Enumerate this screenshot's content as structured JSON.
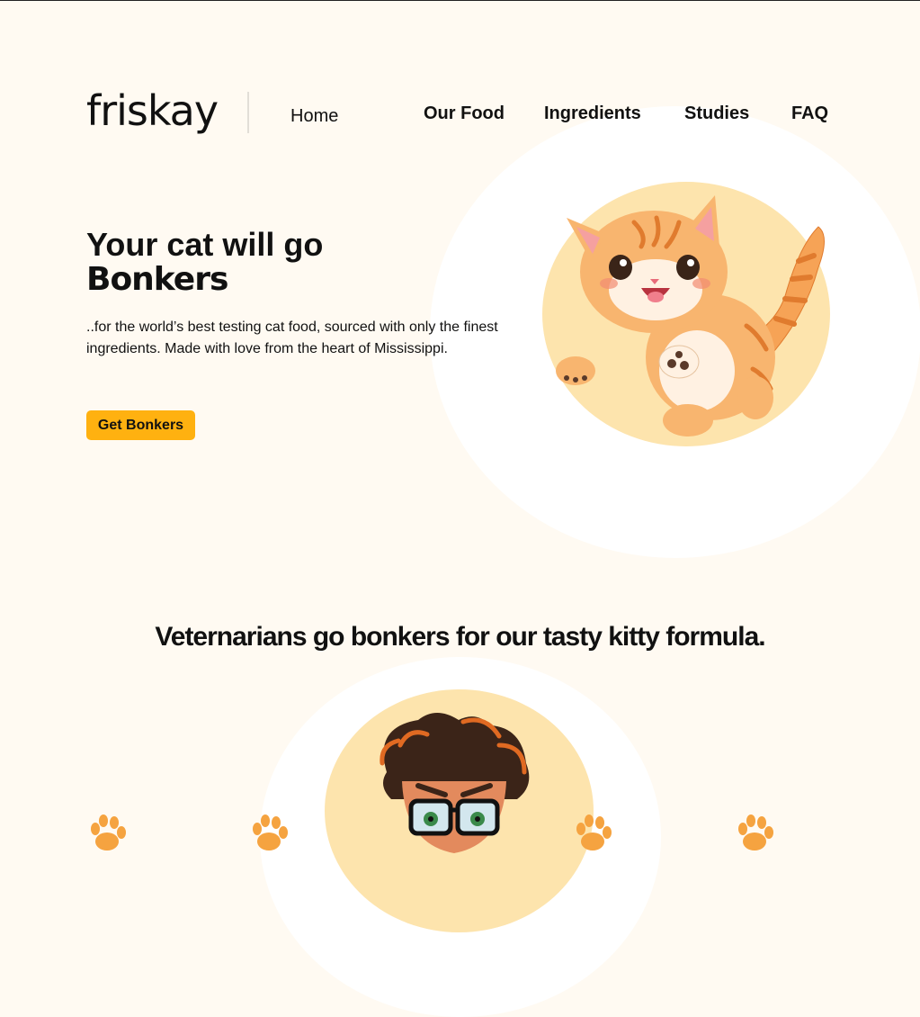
{
  "header": {
    "logo_text": "friskay",
    "nav": {
      "home": "Home",
      "our_food": "Our Food",
      "ingredients": "Ingredients",
      "studies": "Studies",
      "faq": "FAQ"
    }
  },
  "hero": {
    "title_line1": "Your cat will go",
    "title_line2": "Bonkers",
    "description": "..for the world’s best testing cat food, sourced with only the finest ingredients. Made with love from the heart of Mississippi.",
    "cta_label": "Get Bonkers",
    "image": "kitten-illustration"
  },
  "vets": {
    "title": "Veternarians go bonkers for our tasty kitty formula.",
    "image": "veterinarian-illustration",
    "paw_icons": [
      "paw-icon",
      "paw-icon",
      "paw-icon",
      "paw-icon"
    ]
  },
  "colors": {
    "background": "#fffaf2",
    "accent": "#ffb110",
    "image_circle": "#fde4ad",
    "text": "#111111"
  }
}
